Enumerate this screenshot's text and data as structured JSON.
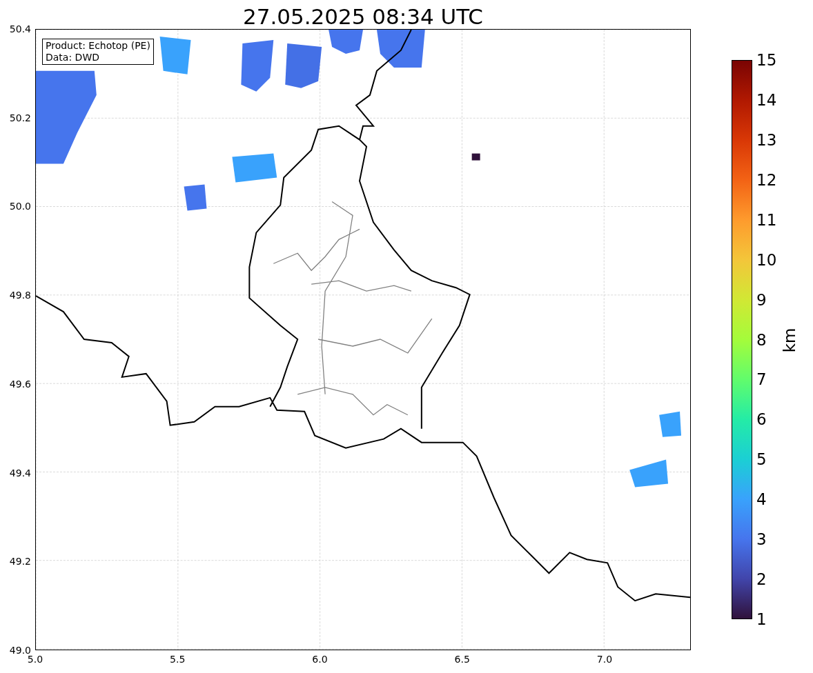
{
  "title": "27.05.2025 08:34 UTC",
  "annotation": [
    "Product: Echotop (PE)",
    "Data: DWD"
  ],
  "y_axis": {
    "ticks": [
      "50.4",
      "50.2",
      "50.0",
      "49.8",
      "49.6",
      "49.4",
      "49.2",
      "49.0"
    ]
  },
  "x_axis": {
    "ticks": [
      "5.0",
      "5.5",
      "6.0",
      "6.5",
      "7.0"
    ]
  },
  "colorbar": {
    "label": "km",
    "ticks": [
      "15",
      "14",
      "13",
      "12",
      "11",
      "10",
      "9",
      "8",
      "7",
      "6",
      "5",
      "4",
      "3",
      "2",
      "1"
    ]
  }
}
